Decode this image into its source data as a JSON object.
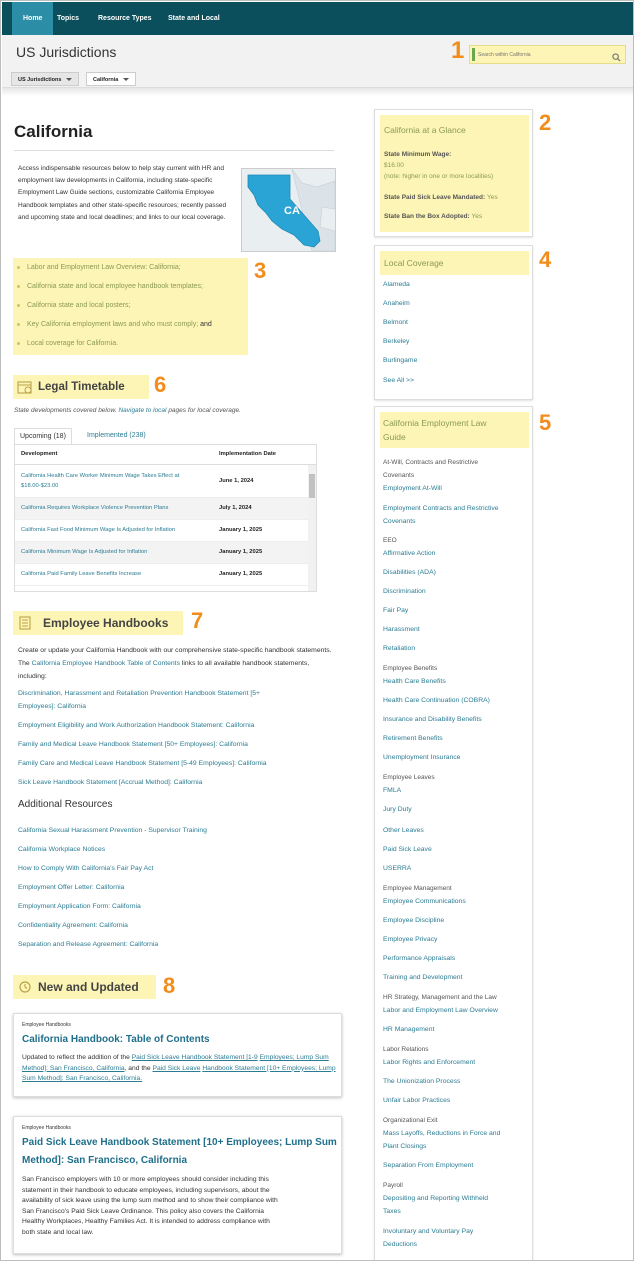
{
  "nav": {
    "items": [
      "Home",
      "Topics",
      "Resource Types",
      "State and Local"
    ]
  },
  "header": {
    "title": "US Jurisdictions",
    "search_placeholder": "Search within California"
  },
  "breadcrumb": [
    "US Jurisdictions",
    "California"
  ],
  "annotations": [
    "1",
    "2",
    "3",
    "4",
    "5",
    "6",
    "7",
    "8"
  ],
  "page": {
    "title": "California",
    "intro": "Access indispensable resources below to help stay current with HR and employment law developments in California, including state-specific Employment Law Guide sections, customizable California Employee Handbook templates and other state-specific resources; recently passed and upcoming state and local deadlines; and links to our local coverage.",
    "map_label": "CA"
  },
  "intro_links": [
    "Labor and Employment Law Overview: California;",
    "California state and local employee handbook templates;",
    "California state and local posters;",
    "Key California employment laws and who must comply;",
    "and",
    "Local coverage for California."
  ],
  "legal_timetable": {
    "heading": "Legal Timetable",
    "sub_pre": "State developments covered below.",
    "sub_link": "Navigate to local",
    "sub_post": "pages for local coverage.",
    "tabs": [
      "Upcoming (18)",
      "Implemented (238)"
    ],
    "columns": [
      "Development",
      "Implementation Date"
    ],
    "rows": [
      {
        "dev": "California Health Care Worker Minimum Wage Takes Effect at $18.00-$23.00",
        "date": "June 1, 2024"
      },
      {
        "dev": "California Requires Workplace Violence Prevention Plans",
        "date": "July 1, 2024"
      },
      {
        "dev": "California Fast Food Minimum Wage Is Adjusted for Inflation",
        "date": "January 1, 2025"
      },
      {
        "dev": "California Minimum Wage Is Adjusted for Inflation",
        "date": "January 1, 2025"
      },
      {
        "dev": "California Paid Family Leave Benefits Increase",
        "date": "January 1, 2025"
      }
    ]
  },
  "handbooks": {
    "heading": "Employee Handbooks",
    "p1": "Create or update your California Handbook with our comprehensive state-specific handbook statements. The",
    "p_link": "California Employee Handbook Table of Contents",
    "p2": "links to all available handbook statements, including:",
    "links": [
      "Discrimination, Harassment and Retaliation Prevention Handbook Statement [5+",
      "Employees]: California",
      "Employment Eligibility and Work Authorization Handbook Statement: California",
      "Family and Medical Leave Handbook Statement [50+ Employees]: California",
      "Family Care and Medical Leave Handbook Statement [5-49 Employees]: California",
      "Sick Leave Handbook Statement [Accrual Method]: California"
    ]
  },
  "additional": {
    "heading": "Additional Resources",
    "links": [
      "California Sexual Harassment Prevention - Supervisor Training",
      "California Workplace Notices",
      "How to Comply With California's Fair Pay Act",
      "Employment Offer Letter: California",
      "Employment Application Form: California",
      "Confidentiality Agreement: California",
      "Separation and Release Agreement: California"
    ]
  },
  "new_updated": {
    "heading": "New and Updated",
    "cards": [
      {
        "category": "Employee Handbooks",
        "title": "California Handbook: Table of Contents",
        "body_pre": "Updated to reflect the addition of the",
        "link1a": "Paid Sick Leave Handbook Statement [1-9",
        "link1b": "Employees; Lump Sum Method]: San Francisco, California",
        "mid": ", and the",
        "link2a": "Paid Sick Leave",
        "link2b": "Handbook Statement [10+ Employees; Lump Sum Method]: San Francisco, California.",
        "body_tail": ""
      },
      {
        "category": "Employee Handbooks",
        "title_l1": "Paid Sick Leave Handbook Statement [10+ Employees; Lump Sum",
        "title_l2": "Method]: San Francisco, California",
        "body": [
          "San Francisco employers with 10 or more employees should consider including this",
          "statement in their handbook to educate employees, including supervisors, about the",
          "availability of sick leave using the lump sum method and to show their compliance with",
          "San Francisco's Paid Sick Leave Ordinance. This policy also covers the California",
          "Healthy Workplaces, Healthy Families Act. It is intended to address compliance with",
          "both state and local law."
        ]
      }
    ]
  },
  "glance": {
    "title": "California at a Glance",
    "min_wage_label": "State Minimum Wage:",
    "min_wage_value": "$16.00",
    "min_wage_note": "(note: higher in one or more localities)",
    "sick_label": "State Paid Sick Leave Mandated:",
    "sick_value": "Yes",
    "btb_label": "State Ban the Box Adopted:",
    "btb_value": "Yes"
  },
  "local": {
    "title": "Local Coverage",
    "items": [
      "Alameda",
      "Anaheim",
      "Belmont",
      "Berkeley",
      "Burlingame"
    ],
    "see_all": "See All >>"
  },
  "guide": {
    "title_l1": "California Employment Law",
    "title_l2": "Guide",
    "rows": [
      {
        "t": "g",
        "s": "At-Will, Contracts and Restrictive"
      },
      {
        "t": "g",
        "s": "Covenants"
      },
      {
        "t": "l",
        "s": "Employment At-Will"
      },
      {
        "t": "l",
        "s": "Employment Contracts and Restrictive"
      },
      {
        "t": "l",
        "s": "Covenants"
      },
      {
        "t": "g",
        "s": "EEO"
      },
      {
        "t": "l",
        "s": "Affirmative Action"
      },
      {
        "t": "l",
        "s": "Disabilities (ADA)"
      },
      {
        "t": "l",
        "s": "Discrimination"
      },
      {
        "t": "l",
        "s": "Fair Pay"
      },
      {
        "t": "l",
        "s": "Harassment"
      },
      {
        "t": "l",
        "s": "Retaliation"
      },
      {
        "t": "g",
        "s": "Employee Benefits"
      },
      {
        "t": "l",
        "s": "Health Care Benefits"
      },
      {
        "t": "l",
        "s": "Health Care Continuation (COBRA)"
      },
      {
        "t": "l",
        "s": "Insurance and Disability Benefits"
      },
      {
        "t": "l",
        "s": "Retirement Benefits"
      },
      {
        "t": "l",
        "s": "Unemployment Insurance"
      },
      {
        "t": "g",
        "s": "Employee Leaves"
      },
      {
        "t": "l",
        "s": "FMLA"
      },
      {
        "t": "l",
        "s": "Jury Duty"
      },
      {
        "t": "l",
        "s": "Other Leaves"
      },
      {
        "t": "l",
        "s": "Paid Sick Leave"
      },
      {
        "t": "l",
        "s": "USERRA"
      },
      {
        "t": "g",
        "s": "Employee Management"
      },
      {
        "t": "l",
        "s": "Employee Communications"
      },
      {
        "t": "l",
        "s": "Employee Discipline"
      },
      {
        "t": "l",
        "s": "Employee Privacy"
      },
      {
        "t": "l",
        "s": "Performance Appraisals"
      },
      {
        "t": "l",
        "s": "Training and Development"
      },
      {
        "t": "g",
        "s": "HR Strategy, Management and the Law"
      },
      {
        "t": "l",
        "s": "Labor and Employment Law Overview"
      },
      {
        "t": "l",
        "s": "HR Management"
      },
      {
        "t": "g",
        "s": "Labor Relations"
      },
      {
        "t": "l",
        "s": "Labor Rights and Enforcement"
      },
      {
        "t": "l",
        "s": "The Unionization Process"
      },
      {
        "t": "l",
        "s": "Unfair Labor Practices"
      },
      {
        "t": "g",
        "s": "Organizational Exit"
      },
      {
        "t": "l",
        "s": "Mass Layoffs, Reductions in Force and"
      },
      {
        "t": "l",
        "s": "Plant Closings"
      },
      {
        "t": "l",
        "s": "Separation From Employment"
      },
      {
        "t": "g",
        "s": "Payroll"
      },
      {
        "t": "l",
        "s": "Depositing and Reporting Withheld"
      },
      {
        "t": "l",
        "s": "Taxes"
      },
      {
        "t": "l",
        "s": "Involuntary and Voluntary Pay"
      },
      {
        "t": "l",
        "s": "Deductions"
      }
    ]
  },
  "colors": {
    "nav_bg": "#0b4f5c",
    "nav_active": "#2b8ea6",
    "link": "#2b7c93",
    "highlight": "#fdf5b5",
    "badge": "#f28c1b",
    "olive": "#8a9a55"
  }
}
